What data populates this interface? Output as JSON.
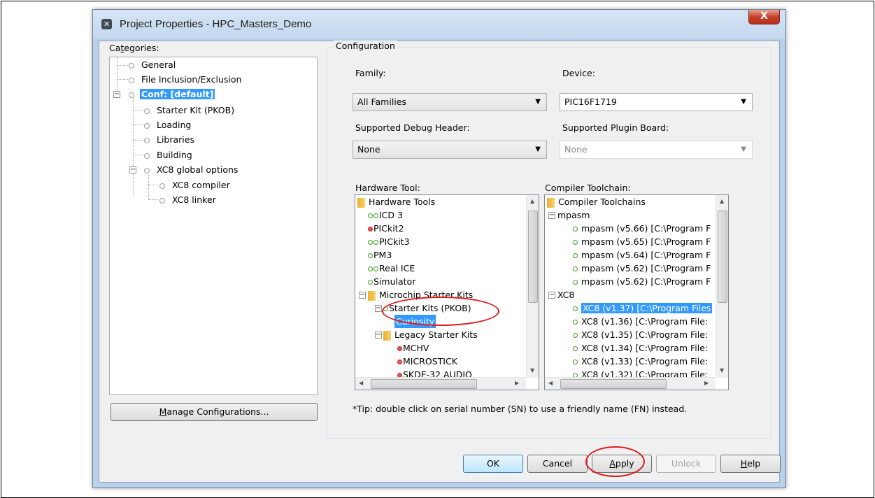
{
  "window": {
    "title": "Project Properties - HPC_Masters_Demo",
    "close_label": "X"
  },
  "categories": {
    "label_pre": "Ca",
    "label_u": "t",
    "label_post": "egories:",
    "items": [
      {
        "label": "General"
      },
      {
        "label": "File Inclusion/Exclusion"
      },
      {
        "label": "Conf: [default]"
      },
      {
        "label": "Starter Kit (PKOB)"
      },
      {
        "label": "Loading"
      },
      {
        "label": "Libraries"
      },
      {
        "label": "Building"
      },
      {
        "label": "XC8 global options"
      },
      {
        "label": "XC8 compiler"
      },
      {
        "label": "XC8 linker"
      }
    ],
    "manage_pre": "",
    "manage_u": "M",
    "manage_post": "anage Configurations..."
  },
  "configuration": {
    "group_title": "Configuration",
    "family_label": "Family:",
    "family_value": "All Families",
    "device_label": "Device:",
    "device_value": "PIC16F1719",
    "debug_header_label": "Supported Debug Header:",
    "debug_header_value": "None",
    "plugin_board_label": "Supported Plugin Board:",
    "plugin_board_value": "None",
    "hardware_tool_label": "Hardware Tool:",
    "compiler_label": "Compiler Toolchain:",
    "hardware_tools": [
      {
        "label": "Hardware Tools"
      },
      {
        "label": "ICD 3"
      },
      {
        "label": "PICkit2"
      },
      {
        "label": "PICkit3"
      },
      {
        "label": "PM3"
      },
      {
        "label": "Real ICE"
      },
      {
        "label": "Simulator"
      },
      {
        "label": "Microchip Starter Kits"
      },
      {
        "label": "Starter Kits (PKOB)"
      },
      {
        "label": "Curiosity"
      },
      {
        "label": "Legacy Starter Kits"
      },
      {
        "label": "MCHV"
      },
      {
        "label": "MICROSTICK"
      },
      {
        "label": "SKDE-32 AUDIO"
      }
    ],
    "toolchains": [
      {
        "label": "Compiler Toolchains"
      },
      {
        "label": "mpasm"
      },
      {
        "label": "mpasm (v5.66) [C:\\Program F"
      },
      {
        "label": "mpasm (v5.65) [C:\\Program F"
      },
      {
        "label": "mpasm (v5.64) [C:\\Program F"
      },
      {
        "label": "mpasm (v5.62) [C:\\Program F"
      },
      {
        "label": "mpasm (v5.62) [C:\\Program F"
      },
      {
        "label": "XC8"
      },
      {
        "label": "XC8 (v1.37) [C:\\Program Files"
      },
      {
        "label": "XC8 (v1.36) [C:\\Program File:"
      },
      {
        "label": "XC8 (v1.35) [C:\\Program File:"
      },
      {
        "label": "XC8 (v1.34) [C:\\Program File:"
      },
      {
        "label": "XC8 (v1.33) [C:\\Program File:"
      },
      {
        "label": "XC8 (v1.32) [C:\\Program File:"
      }
    ],
    "tip": "*Tip: double click on serial number (SN) to use a friendly name (FN) instead."
  },
  "buttons": {
    "ok": "OK",
    "cancel": "Cancel",
    "apply_u": "A",
    "apply_post": "pply",
    "unlock": "Unlock",
    "help_u": "H",
    "help_post": "elp"
  },
  "colors": {
    "selection": "#3399ff",
    "annotation": "#e01a1a"
  }
}
